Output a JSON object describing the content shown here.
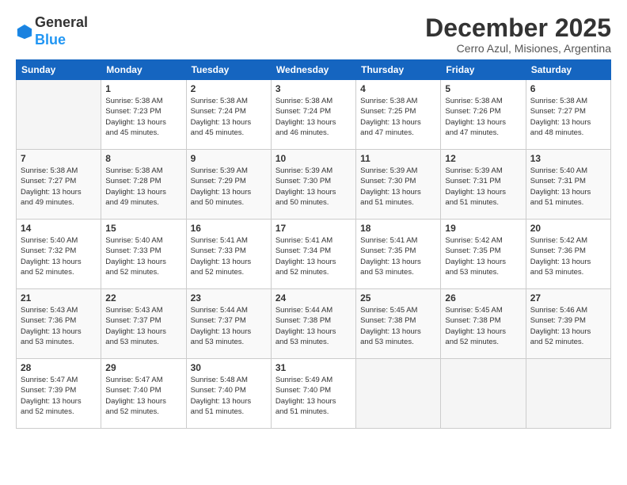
{
  "logo": {
    "general": "General",
    "blue": "Blue"
  },
  "header": {
    "month": "December 2025",
    "location": "Cerro Azul, Misiones, Argentina"
  },
  "weekdays": [
    "Sunday",
    "Monday",
    "Tuesday",
    "Wednesday",
    "Thursday",
    "Friday",
    "Saturday"
  ],
  "weeks": [
    [
      {
        "day": "",
        "info": ""
      },
      {
        "day": "1",
        "info": "Sunrise: 5:38 AM\nSunset: 7:23 PM\nDaylight: 13 hours\nand 45 minutes."
      },
      {
        "day": "2",
        "info": "Sunrise: 5:38 AM\nSunset: 7:24 PM\nDaylight: 13 hours\nand 45 minutes."
      },
      {
        "day": "3",
        "info": "Sunrise: 5:38 AM\nSunset: 7:24 PM\nDaylight: 13 hours\nand 46 minutes."
      },
      {
        "day": "4",
        "info": "Sunrise: 5:38 AM\nSunset: 7:25 PM\nDaylight: 13 hours\nand 47 minutes."
      },
      {
        "day": "5",
        "info": "Sunrise: 5:38 AM\nSunset: 7:26 PM\nDaylight: 13 hours\nand 47 minutes."
      },
      {
        "day": "6",
        "info": "Sunrise: 5:38 AM\nSunset: 7:27 PM\nDaylight: 13 hours\nand 48 minutes."
      }
    ],
    [
      {
        "day": "7",
        "info": "Sunrise: 5:38 AM\nSunset: 7:27 PM\nDaylight: 13 hours\nand 49 minutes."
      },
      {
        "day": "8",
        "info": "Sunrise: 5:38 AM\nSunset: 7:28 PM\nDaylight: 13 hours\nand 49 minutes."
      },
      {
        "day": "9",
        "info": "Sunrise: 5:39 AM\nSunset: 7:29 PM\nDaylight: 13 hours\nand 50 minutes."
      },
      {
        "day": "10",
        "info": "Sunrise: 5:39 AM\nSunset: 7:30 PM\nDaylight: 13 hours\nand 50 minutes."
      },
      {
        "day": "11",
        "info": "Sunrise: 5:39 AM\nSunset: 7:30 PM\nDaylight: 13 hours\nand 51 minutes."
      },
      {
        "day": "12",
        "info": "Sunrise: 5:39 AM\nSunset: 7:31 PM\nDaylight: 13 hours\nand 51 minutes."
      },
      {
        "day": "13",
        "info": "Sunrise: 5:40 AM\nSunset: 7:31 PM\nDaylight: 13 hours\nand 51 minutes."
      }
    ],
    [
      {
        "day": "14",
        "info": "Sunrise: 5:40 AM\nSunset: 7:32 PM\nDaylight: 13 hours\nand 52 minutes."
      },
      {
        "day": "15",
        "info": "Sunrise: 5:40 AM\nSunset: 7:33 PM\nDaylight: 13 hours\nand 52 minutes."
      },
      {
        "day": "16",
        "info": "Sunrise: 5:41 AM\nSunset: 7:33 PM\nDaylight: 13 hours\nand 52 minutes."
      },
      {
        "day": "17",
        "info": "Sunrise: 5:41 AM\nSunset: 7:34 PM\nDaylight: 13 hours\nand 52 minutes."
      },
      {
        "day": "18",
        "info": "Sunrise: 5:41 AM\nSunset: 7:35 PM\nDaylight: 13 hours\nand 53 minutes."
      },
      {
        "day": "19",
        "info": "Sunrise: 5:42 AM\nSunset: 7:35 PM\nDaylight: 13 hours\nand 53 minutes."
      },
      {
        "day": "20",
        "info": "Sunrise: 5:42 AM\nSunset: 7:36 PM\nDaylight: 13 hours\nand 53 minutes."
      }
    ],
    [
      {
        "day": "21",
        "info": "Sunrise: 5:43 AM\nSunset: 7:36 PM\nDaylight: 13 hours\nand 53 minutes."
      },
      {
        "day": "22",
        "info": "Sunrise: 5:43 AM\nSunset: 7:37 PM\nDaylight: 13 hours\nand 53 minutes."
      },
      {
        "day": "23",
        "info": "Sunrise: 5:44 AM\nSunset: 7:37 PM\nDaylight: 13 hours\nand 53 minutes."
      },
      {
        "day": "24",
        "info": "Sunrise: 5:44 AM\nSunset: 7:38 PM\nDaylight: 13 hours\nand 53 minutes."
      },
      {
        "day": "25",
        "info": "Sunrise: 5:45 AM\nSunset: 7:38 PM\nDaylight: 13 hours\nand 53 minutes."
      },
      {
        "day": "26",
        "info": "Sunrise: 5:45 AM\nSunset: 7:38 PM\nDaylight: 13 hours\nand 52 minutes."
      },
      {
        "day": "27",
        "info": "Sunrise: 5:46 AM\nSunset: 7:39 PM\nDaylight: 13 hours\nand 52 minutes."
      }
    ],
    [
      {
        "day": "28",
        "info": "Sunrise: 5:47 AM\nSunset: 7:39 PM\nDaylight: 13 hours\nand 52 minutes."
      },
      {
        "day": "29",
        "info": "Sunrise: 5:47 AM\nSunset: 7:40 PM\nDaylight: 13 hours\nand 52 minutes."
      },
      {
        "day": "30",
        "info": "Sunrise: 5:48 AM\nSunset: 7:40 PM\nDaylight: 13 hours\nand 51 minutes."
      },
      {
        "day": "31",
        "info": "Sunrise: 5:49 AM\nSunset: 7:40 PM\nDaylight: 13 hours\nand 51 minutes."
      },
      {
        "day": "",
        "info": ""
      },
      {
        "day": "",
        "info": ""
      },
      {
        "day": "",
        "info": ""
      }
    ]
  ]
}
